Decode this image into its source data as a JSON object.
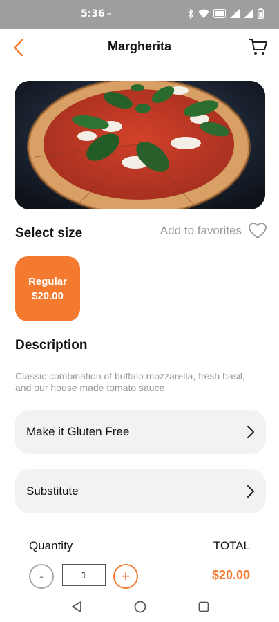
{
  "status_bar": {
    "time": "5:36",
    "extra": "∞",
    "icons": [
      "bluetooth-icon",
      "wifi-icon",
      "volte-icon",
      "signal-icon",
      "signal-icon",
      "battery-icon"
    ]
  },
  "header": {
    "title": "Margherita",
    "back_icon": "chevron-left-icon",
    "cart_icon": "cart-icon"
  },
  "hero": {
    "image_icon": "pizza-photo"
  },
  "size_section": {
    "title": "Select size",
    "favorites_label": "Add to favorites",
    "favorites_icon": "heart-outline-icon",
    "options": [
      {
        "name": "Regular",
        "price": "$20.00"
      }
    ]
  },
  "description": {
    "title": "Description",
    "text": "Classic combination of buffalo mozzarella, fresh basil, and our house made tomato sauce"
  },
  "options": {
    "gluten_free": "Make it Gluten Free",
    "substitute": "Substitute"
  },
  "footer": {
    "quantity_label": "Quantity",
    "total_label": "TOTAL",
    "minus": "-",
    "plus": "+",
    "quantity_value": "1",
    "total_value": "$20.00"
  },
  "colors": {
    "accent": "#f47a2f",
    "status_bar": "#9e9e9e",
    "card_bg": "#f2f2f2"
  }
}
